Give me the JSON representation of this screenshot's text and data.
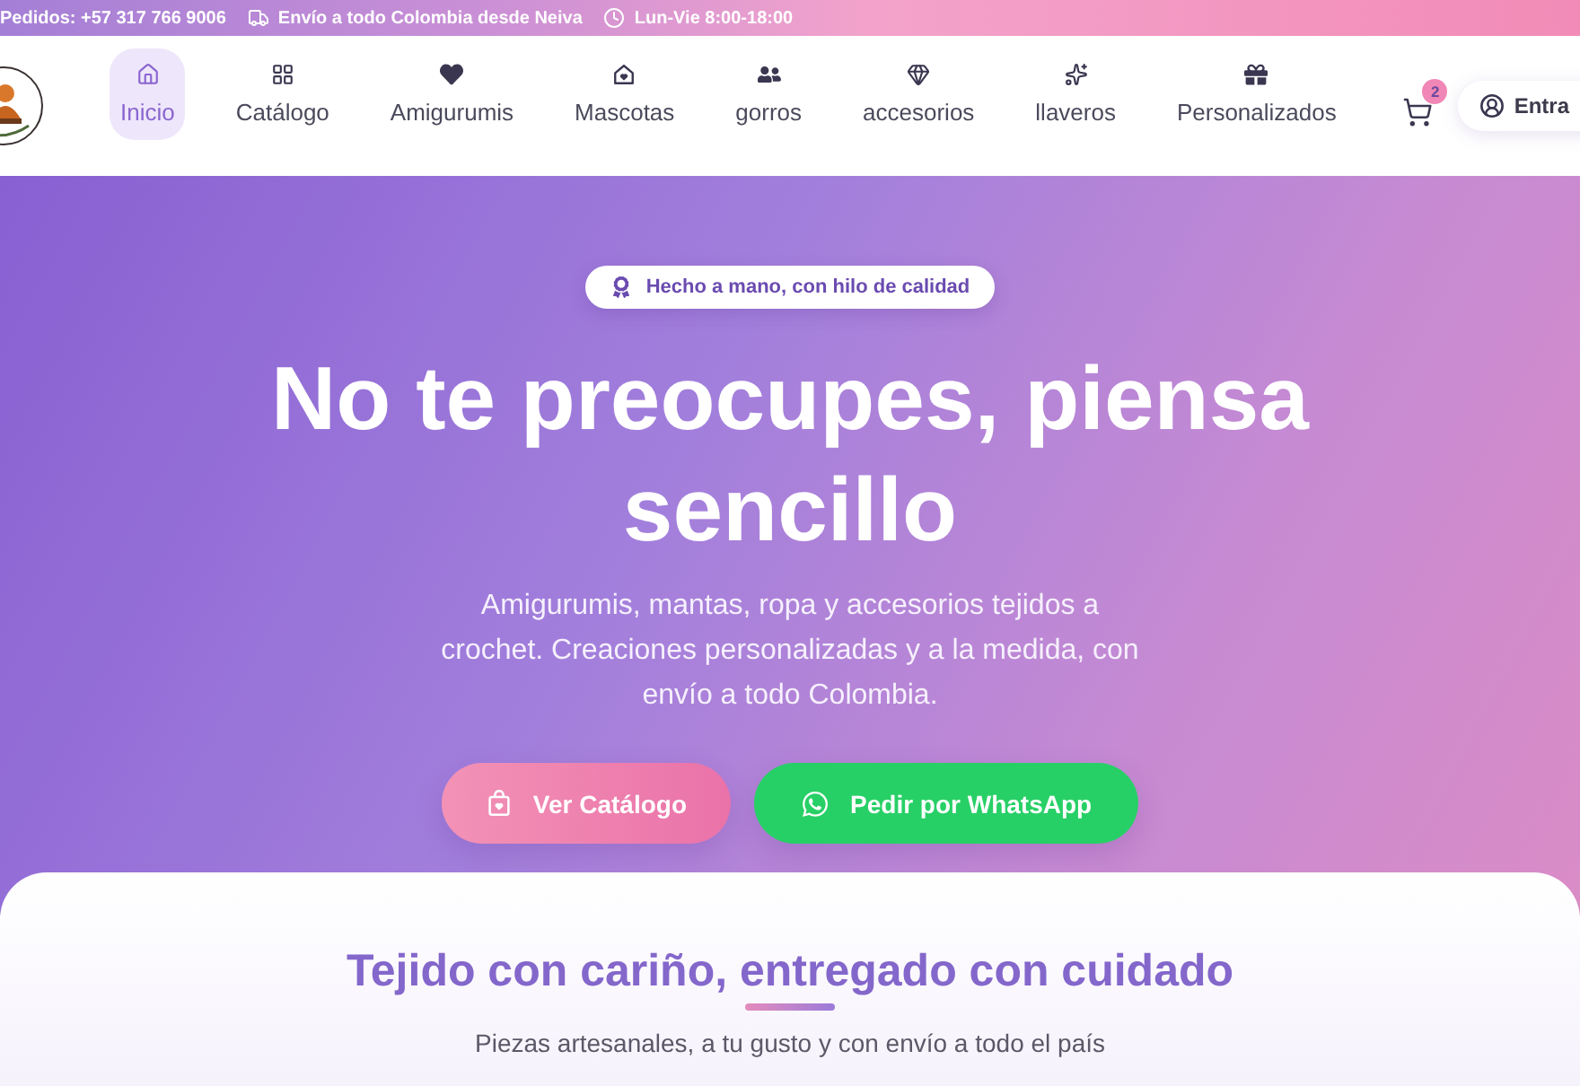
{
  "top_bar": {
    "items": [
      {
        "text": "Pedidos: +57 317 766 9006"
      },
      {
        "text": "Envío a todo Colombia desde Neiva"
      },
      {
        "text": "Lun-Vie 8:00-18:00"
      }
    ]
  },
  "nav": {
    "items": [
      {
        "label": "Inicio",
        "selected": true
      },
      {
        "label": "Catálogo",
        "selected": false
      },
      {
        "label": "Amigurumis",
        "selected": false
      },
      {
        "label": "Mascotas",
        "selected": false
      },
      {
        "label": "gorros",
        "selected": false
      },
      {
        "label": "accesorios",
        "selected": false
      },
      {
        "label": "llaveros",
        "selected": false
      },
      {
        "label": "Personalizados",
        "selected": false
      }
    ],
    "cart": {
      "count": "2"
    },
    "login": {
      "label": "Entra"
    }
  },
  "hero": {
    "badge": "Hecho a mano, con hilo de calidad",
    "title": "No te preocupes, piensa sencillo",
    "text": "Amigurumis, mantas, ropa y accesorios tejidos a crochet. Creaciones personalizadas y a la medida, con envío a todo Colombia.",
    "buttons": [
      {
        "label": "Ver Catálogo",
        "kind": "primary"
      },
      {
        "label": "Pedir por WhatsApp",
        "kind": "whatsapp"
      }
    ]
  },
  "section": {
    "title": "Tejido con cariño, entregado con cuidado",
    "subtitle": "Piezas artesanales, a tu gusto y con envío a todo el país"
  }
}
